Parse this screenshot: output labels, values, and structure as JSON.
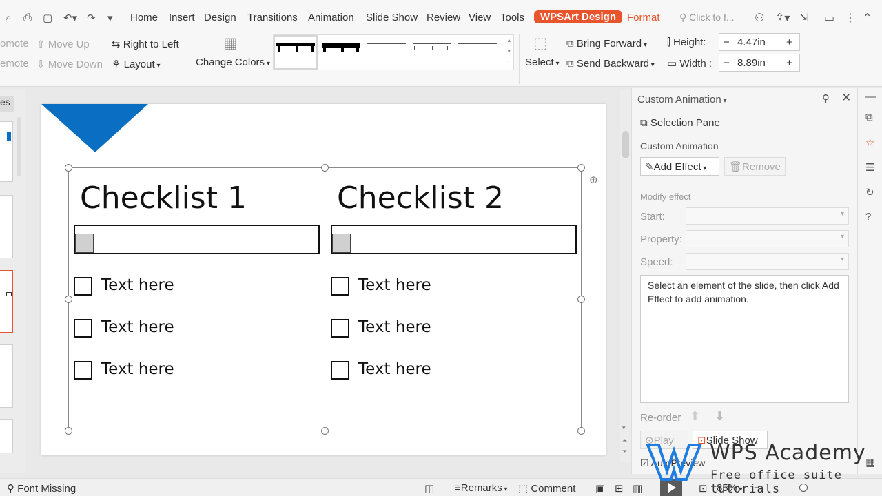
{
  "menubar": {
    "tabs": [
      "Home",
      "Insert",
      "Design",
      "Transitions",
      "Animation",
      "Slide Show",
      "Review",
      "View",
      "Tools",
      "WPSArt Design",
      "Format"
    ],
    "search_placeholder": "Click to f..."
  },
  "ribbon": {
    "promote": "omote",
    "demote": "emote",
    "move_up": "Move Up",
    "move_down": "Move Down",
    "right_to_left": "Right to Left",
    "layout": "Layout",
    "change_colors": "Change Colors",
    "select": "Select",
    "bring_forward": "Bring Forward",
    "send_backward": "Send Backward",
    "height_label": "Height:",
    "height_value": "4.47in",
    "width_label": "Width :",
    "width_value": "8.89in"
  },
  "thumbs": {
    "tab_label": "es"
  },
  "slide": {
    "col1": {
      "title": "Checklist 1",
      "items": [
        "Text here",
        "Text here",
        "Text here"
      ]
    },
    "col2": {
      "title": "Checklist 2",
      "items": [
        "Text here",
        "Text here",
        "Text here"
      ]
    },
    "accent_color": "#0a6fc2"
  },
  "pane": {
    "header": "Custom Animation",
    "selection_pane": "Selection Pane",
    "section": "Custom Animation",
    "add_effect": "Add Effect",
    "remove": "Remove",
    "modify_effect": "Modify effect",
    "start": "Start:",
    "property": "Property:",
    "speed": "Speed:",
    "info": "Select an element of the slide, then click Add Effect to add animation.",
    "reorder": "Re-order",
    "play": "Play",
    "slide_show": "Slide Show",
    "auto_preview": "AutoPreview"
  },
  "status": {
    "font_missing": "Font Missing",
    "remarks": "Remarks",
    "comment": "Comment",
    "zoom": "85%"
  },
  "watermark": {
    "title": "WPS Academy",
    "subtitle": "Free office suite tutorials"
  }
}
